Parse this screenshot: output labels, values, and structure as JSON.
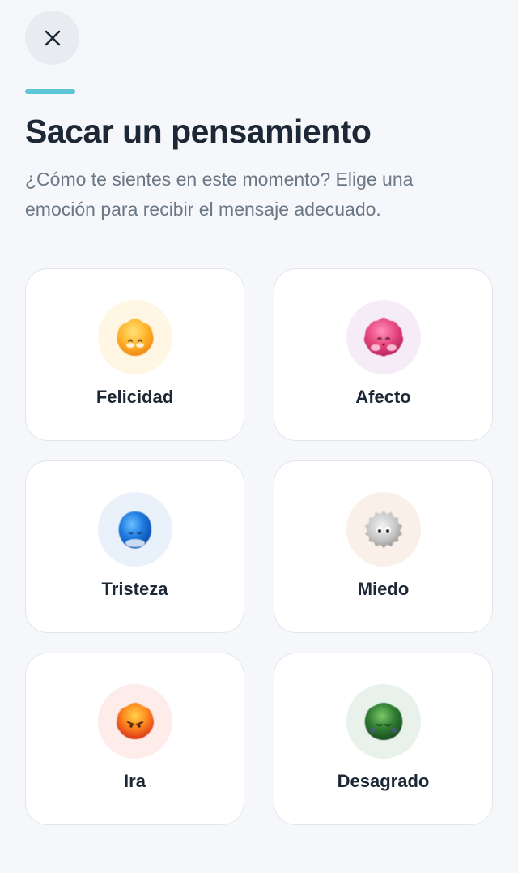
{
  "header": {
    "close_icon": "close-icon",
    "title": "Sacar un pensamiento",
    "subtitle": "¿Cómo te sientes en este momento? Elige una emoción para recibir el mensaje adecuado."
  },
  "colors": {
    "accent": "#5cc6d6",
    "background": "#f5f7fa",
    "title": "#1d2836",
    "subtitle": "#6b7785"
  },
  "emotions": [
    {
      "label": "Felicidad",
      "icon": "happiness-blob-icon",
      "halo": "#fff6e3",
      "color": "#f9a825"
    },
    {
      "label": "Afecto",
      "icon": "affection-blob-icon",
      "halo": "#f6ecf7",
      "color": "#e0457b"
    },
    {
      "label": "Tristeza",
      "icon": "sadness-blob-icon",
      "halo": "#e9f1fb",
      "color": "#1e7be0"
    },
    {
      "label": "Miedo",
      "icon": "fear-blob-icon",
      "halo": "#fbefe9",
      "color": "#b0b0b0"
    },
    {
      "label": "Ira",
      "icon": "anger-blob-icon",
      "halo": "#fdecea",
      "color": "#f4511e"
    },
    {
      "label": "Desagrado",
      "icon": "disgust-blob-icon",
      "halo": "#e8f2ea",
      "color": "#2e7d32"
    }
  ]
}
